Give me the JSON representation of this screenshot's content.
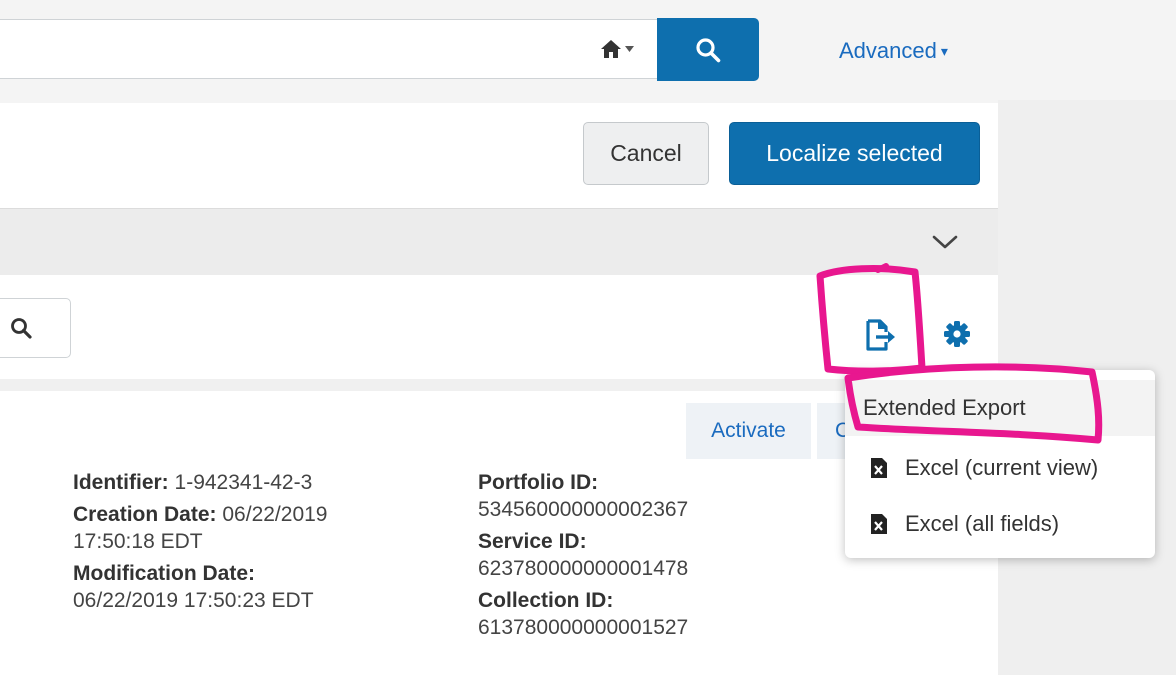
{
  "topbar": {
    "search_value": "",
    "home_icon": "home-icon",
    "search_icon": "search-icon",
    "advanced_label": "Advanced",
    "advanced_caret": "▾"
  },
  "actions": {
    "cancel_label": "Cancel",
    "localize_label": "Localize selected"
  },
  "toolbar": {
    "export_icon": "export-icon",
    "settings_icon": "gear-icon"
  },
  "tabs": {
    "activate_label": "Activate",
    "truncated_label": "C"
  },
  "record": {
    "identifier_label": "Identifier:",
    "identifier_value": "1-942341-42-3",
    "creation_label": "Creation Date:",
    "creation_value_1": "06/22/2019",
    "creation_value_2": "17:50:18 EDT",
    "modification_label": "Modification Date:",
    "modification_value": "06/22/2019 17:50:23 EDT",
    "portfolio_label": "Portfolio ID:",
    "portfolio_value": "534560000000002367",
    "service_label": "Service ID:",
    "service_value": "623780000000001478",
    "collection_label": "Collection ID:",
    "collection_value": "613780000000001527"
  },
  "export_menu": {
    "header": "Extended Export",
    "items": [
      {
        "label": "Excel (current view)",
        "icon": "excel-file-icon"
      },
      {
        "label": "Excel (all fields)",
        "icon": "excel-file-icon"
      }
    ]
  },
  "colors": {
    "primary": "#0e6fae",
    "link": "#1a6bbf",
    "annotation": "#e8178f"
  }
}
